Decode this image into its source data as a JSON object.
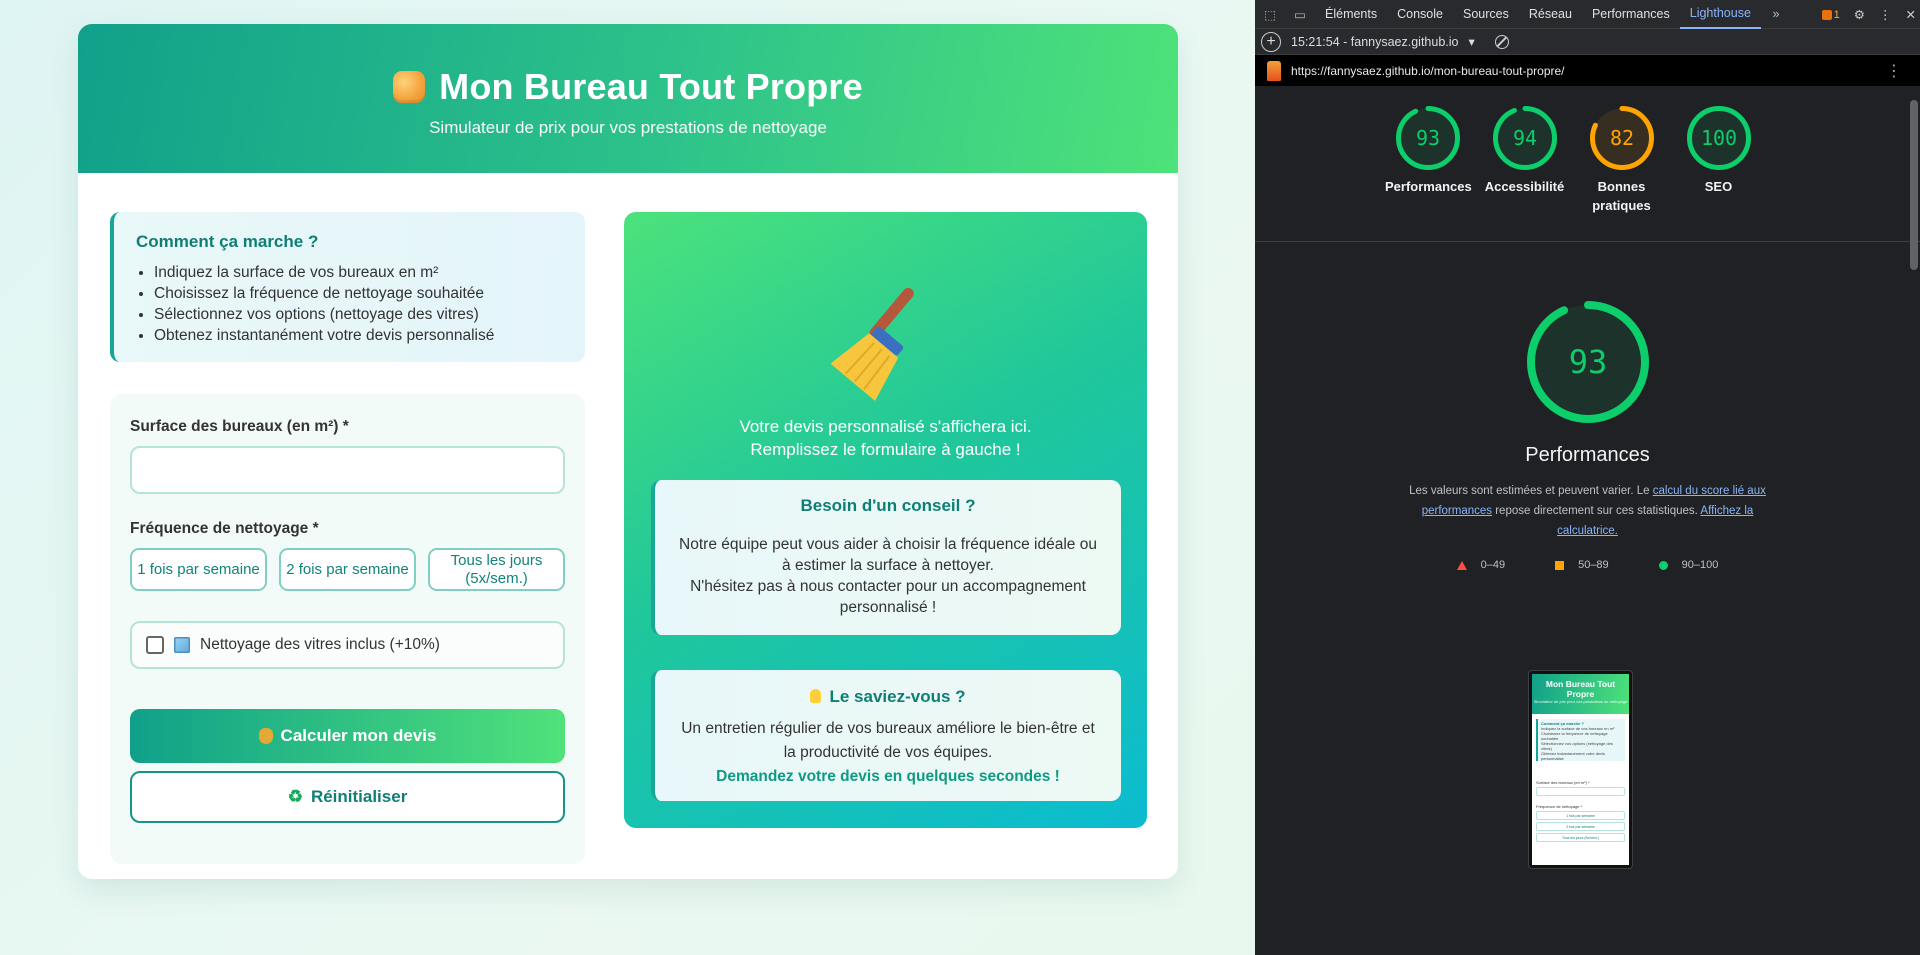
{
  "app": {
    "title": "Mon Bureau Tout Propre",
    "subtitle": "Simulateur de prix pour vos prestations de nettoyage"
  },
  "how": {
    "title": "Comment ça marche ?",
    "steps": [
      "Indiquez la surface de vos bureaux en m²",
      "Choisissez la fréquence de nettoyage souhaitée",
      "Sélectionnez vos options (nettoyage des vitres)",
      "Obtenez instantanément votre devis personnalisé"
    ]
  },
  "form": {
    "surface_label": "Surface des bureaux (en m²) *",
    "surface_value": "",
    "frequency_label": "Fréquence de nettoyage *",
    "frequencies": [
      "1 fois par semaine",
      "2 fois par semaine",
      "Tous les jours (5x/sem.)"
    ],
    "windows_label": "Nettoyage des vitres inclus (+10%)",
    "windows_checked": false,
    "calc_button": "Calculer mon devis",
    "reset_button": "Réinitialiser"
  },
  "result": {
    "placeholder_line1": "Votre devis personnalisé s'affichera ici.",
    "placeholder_line2": "Remplissez le formulaire à gauche !",
    "advice_title": "Besoin d'un conseil ?",
    "advice_text1": "Notre équipe peut vous aider à choisir la fréquence idéale ou à estimer la surface à nettoyer.",
    "advice_text2": "N'hésitez pas à nous contacter pour un accompagnement personnalisé !",
    "tip_title": "Le saviez-vous ?",
    "tip_text": "Un entretien régulier de vos bureaux améliore le bien-être et la productivité de vos équipes.",
    "tip_cta": "Demandez votre devis en quelques secondes !"
  },
  "devtools": {
    "tabs": [
      "Éléments",
      "Console",
      "Sources",
      "Réseau",
      "Performances",
      "Lighthouse"
    ],
    "active_tab": "Lighthouse",
    "issues_count": "1",
    "report_label": "15:21:54 - fannysaez.github.io",
    "url": "https://fannysaez.github.io/mon-bureau-tout-propre/",
    "scores": [
      {
        "label": "Performances",
        "value": 93,
        "color": "#0cce6b"
      },
      {
        "label": "Accessibilité",
        "value": 94,
        "color": "#0cce6b"
      },
      {
        "label": "Bonnes pratiques",
        "value": 82,
        "color": "#ffa400"
      },
      {
        "label": "SEO",
        "value": 100,
        "color": "#0cce6b"
      }
    ],
    "main_score": 93,
    "main_title": "Performances",
    "desc_prefix": "Les valeurs sont estimées et peuvent varier. Le ",
    "desc_link1": "calcul du score lié aux performances",
    "desc_middle": " repose directement sur ces statistiques. ",
    "desc_link2": "Affichez la calculatrice.",
    "legend": [
      "0–49",
      "50–89",
      "90–100"
    ],
    "thumb": {
      "title": "Mon Bureau Tout Propre",
      "subtitle": "Simulateur de prix pour vos prestations de nettoyage",
      "how_title": "Comment ça marche ?",
      "how_steps": [
        "Indiquez la surface de vos bureaux en m²",
        "Choisissez la fréquence de nettoyage souhaitée",
        "Sélectionnez vos options (nettoyage des vitres)",
        "Obtenez instantanément votre devis personnalisé"
      ],
      "surface_label": "Surface des bureaux (en m²) *",
      "frequency_label": "Fréquence de nettoyage *",
      "options": [
        "1 fois par semaine",
        "2 fois par semaine",
        "Tous les jours (5x/sem.)"
      ]
    }
  }
}
